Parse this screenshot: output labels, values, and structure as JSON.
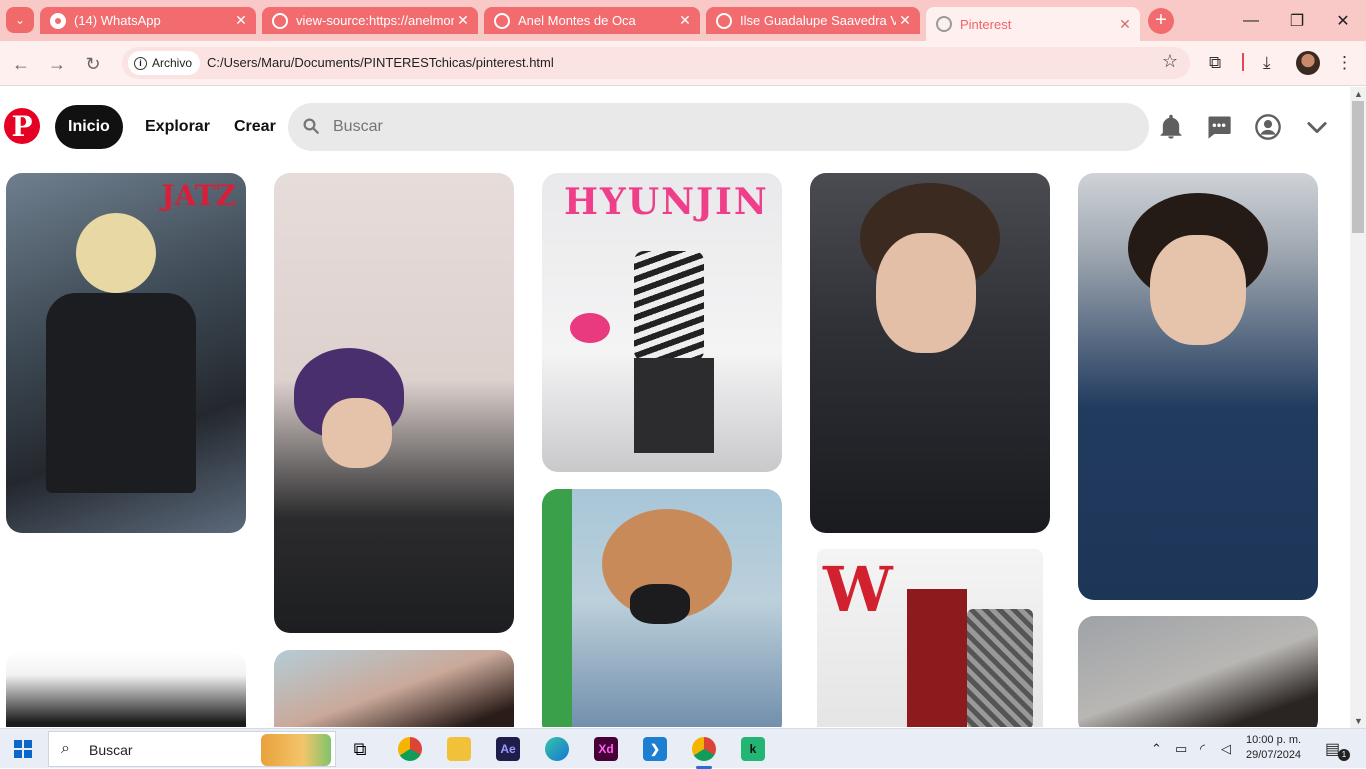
{
  "browser": {
    "tabs": [
      {
        "title": "(14) WhatsApp",
        "icon": "whatsapp-icon"
      },
      {
        "title": "view-source:https://anelmon",
        "icon": "globe-icon"
      },
      {
        "title": "Anel Montes de Oca",
        "icon": "globe-icon"
      },
      {
        "title": "Ilse Guadalupe Saavedra Villa",
        "icon": "globe-icon"
      },
      {
        "title": "Pinterest",
        "icon": "globe-icon",
        "active": true
      }
    ],
    "address": {
      "chip_label": "Archivo",
      "url": "C:/Users/Maru/Documents/PINTERESTchicas/pinterest.html"
    }
  },
  "pinterest": {
    "brand_color": "#e60023",
    "nav": {
      "home": "Inicio",
      "explore": "Explorar",
      "create": "Crear"
    },
    "search": {
      "placeholder": "Buscar"
    },
    "pins": [
      {
        "caption": "JATZ"
      },
      {
        "caption": ""
      },
      {
        "caption": "HYUNJIN"
      },
      {
        "caption": ""
      },
      {
        "caption": ""
      },
      {
        "caption": ""
      },
      {
        "caption": "W"
      },
      {
        "caption": ""
      }
    ]
  },
  "taskbar": {
    "search_label": "Buscar",
    "apps": [
      "task-view",
      "chrome",
      "file-explorer",
      "after-effects",
      "edge",
      "adobe-xd",
      "vscode",
      "chrome-profile",
      "kaspersky"
    ],
    "time": "10:00 p. m.",
    "date": "29/07/2024",
    "notifications": "1"
  }
}
